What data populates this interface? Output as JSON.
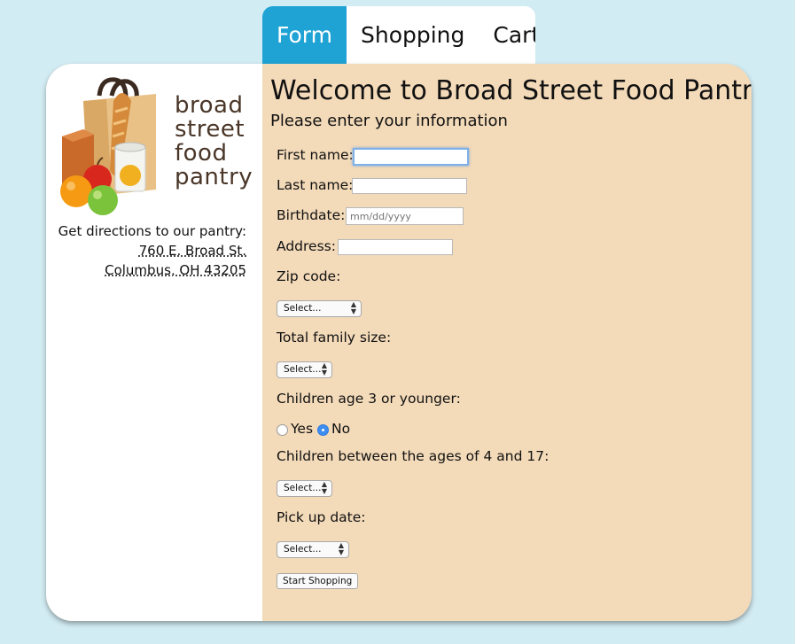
{
  "tabs": [
    {
      "label": "Form"
    },
    {
      "label": "Shopping"
    },
    {
      "label": "Cart"
    }
  ],
  "logo": {
    "lines": [
      "broad",
      "street",
      "food",
      "pantry"
    ]
  },
  "directions": {
    "label": "Get directions to our pantry:",
    "address_line1": "760 E. Broad St.",
    "address_line2": "Columbus, OH 43205"
  },
  "form": {
    "title": "Welcome to Broad Street Food Pantry",
    "subtitle": "Please enter your information",
    "first_name_label": "First name:",
    "first_name_value": "",
    "last_name_label": "Last name:",
    "last_name_value": "",
    "birthdate_label": "Birthdate:",
    "birthdate_placeholder": "mm/dd/yyyy",
    "address_label": "Address:",
    "address_value": "",
    "zip_label": "Zip code:",
    "zip_selected": "Select...",
    "family_size_label": "Total family size:",
    "family_size_selected": "Select...",
    "children_young_label": "Children age 3 or younger:",
    "radio_yes": "Yes",
    "radio_no": "No",
    "radio_selected": "No",
    "children_mid_label": "Children between the ages of 4 and 17:",
    "children_mid_selected": "Select...",
    "pickup_label": "Pick up date:",
    "pickup_selected": "Select...",
    "submit_label": "Start Shopping"
  },
  "colors": {
    "background": "#d2ecf3",
    "tab_active": "#1fa3d5",
    "form_panel": "#f3dab9",
    "sidebar": "#ffffff",
    "radio_checked": "#3d8ef0"
  }
}
